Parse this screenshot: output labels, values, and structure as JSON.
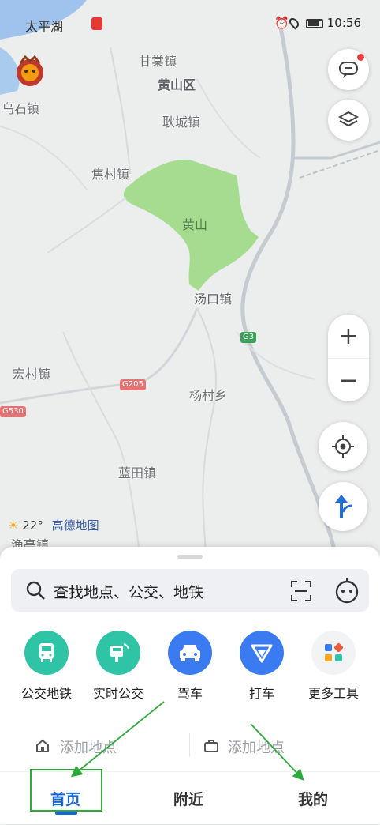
{
  "status_bar": {
    "left_text": "太平湖",
    "time": "10:56"
  },
  "map": {
    "places": {
      "gancao": "甘棠镇",
      "huangshanqu": "黄山区",
      "wushi": "乌石镇",
      "gengcheng": "耿城镇",
      "jiaocun": "焦村镇",
      "huangshan": "黄山",
      "tangkou": "汤口镇",
      "hongcun": "宏村镇",
      "yangcun": "杨村乡",
      "lantian": "蓝田镇",
      "yuting": "渔亭镇"
    },
    "road_badges": {
      "g3": "G3",
      "g205": "G205",
      "g530": "G530"
    },
    "zoom": {
      "in": "+",
      "out": "−"
    }
  },
  "weather": {
    "temp": "22°",
    "brand": "高德地图"
  },
  "search": {
    "placeholder": "查找地点、公交、地铁"
  },
  "tools": [
    {
      "label": "公交地铁",
      "color": "#2ec4a5"
    },
    {
      "label": "实时公交",
      "color": "#2ec4a5"
    },
    {
      "label": "驾车",
      "color": "#3a7bf2"
    },
    {
      "label": "打车",
      "color": "#3a7bf2"
    },
    {
      "label": "更多工具",
      "color": "#f2f3f5"
    }
  ],
  "quick": {
    "home": "添加地点",
    "work": "添加地点"
  },
  "tabs": {
    "home": "首页",
    "nearby": "附近",
    "mine": "我的"
  },
  "colors": {
    "accent": "#1967d2",
    "annotation": "#2eaa3c",
    "park": "#a5dc8f"
  }
}
